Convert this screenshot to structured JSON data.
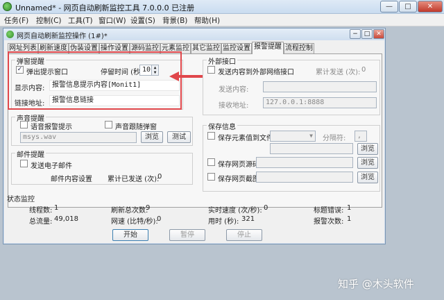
{
  "window": {
    "title": "Unnamed* - 网页自动刷新监控工具 7.0.0.0 已注册",
    "min_glyph": "—",
    "max_glyph": "□",
    "close_glyph": "✕"
  },
  "menu": [
    "任务(F)",
    "控制(C)",
    "工具(T)",
    "窗口(W)",
    "设置(S)",
    "背景(B)",
    "帮助(H)"
  ],
  "child": {
    "title": "网页自动刷新监控操作 (1#)*",
    "min_glyph": "−",
    "max_glyph": "□",
    "close_glyph": "✕"
  },
  "tabs": [
    "网址列表",
    "刷新速度",
    "伪装设置",
    "操作设置",
    "源码监控",
    "元素监控",
    "其它监控",
    "监控设置",
    "报警提醒",
    "流程控制"
  ],
  "popup": {
    "group_title": "弹窗提醒",
    "show_popup_label": "弹出提示窗口",
    "show_popup_checked": "✓",
    "stay_time_label": "停留时间 (秒):",
    "stay_time_value": "10",
    "content_label": "显示内容:",
    "content_value": "报警信息提示内容[Monit1]",
    "link_label": "链接地址:",
    "link_value": "报警信息链接"
  },
  "external": {
    "group_title": "外部接口",
    "send_label": "发送内容到外部网络接口",
    "sent_count_label": "累计发送 (次):",
    "sent_count_value": "0",
    "send_content_label": "发送内容:",
    "send_content_value": "",
    "recv_addr_label": "接收地址:",
    "recv_addr_value": "127.0.0.1:8888"
  },
  "sound": {
    "group_title": "声音提醒",
    "voice_label": "语音报警提示",
    "follow_popup_label": "声音跟随弹窗",
    "file_value": "msys.wav",
    "browse_label": "浏览",
    "test_label": "测试"
  },
  "mail": {
    "group_title": "邮件提醒",
    "send_mail_label": "发送电子邮件",
    "settings_label": "邮件内容设置",
    "sent_label": "累计已发送 (次):",
    "sent_value": "0"
  },
  "save": {
    "group_title": "保存信息",
    "save_elem_label": "保存元素值到文件",
    "separator_label": "分隔符:",
    "separator_value": ",",
    "browse_label": "浏览",
    "save_source_label": "保存网页源码",
    "save_shot_label": "保存网页截图"
  },
  "status": {
    "title": "状态监控",
    "threads_label": "线程数:",
    "threads_value": "1",
    "refresh_total_label": "刷新总次数:",
    "refresh_total_value": "9",
    "rt_speed_label": "实时速度 (次/秒):",
    "rt_speed_value": "0",
    "title_err_label": "标题错误:",
    "title_err_value": "1",
    "flow_label": "总流量:",
    "flow_value": "49,018",
    "net_speed_label": "网速 (比特/秒):",
    "net_speed_value": "0",
    "time_label": "用时 (秒):",
    "time_value": "321",
    "alarm_label": "报警次数:",
    "alarm_value": "1"
  },
  "controls": {
    "start": "开始",
    "pause": "暂停",
    "stop": "停止"
  },
  "watermark": "知乎 @木头软件",
  "colors": {
    "highlight": "#e0474b",
    "title_gradient_top": "#dfeaf6"
  }
}
